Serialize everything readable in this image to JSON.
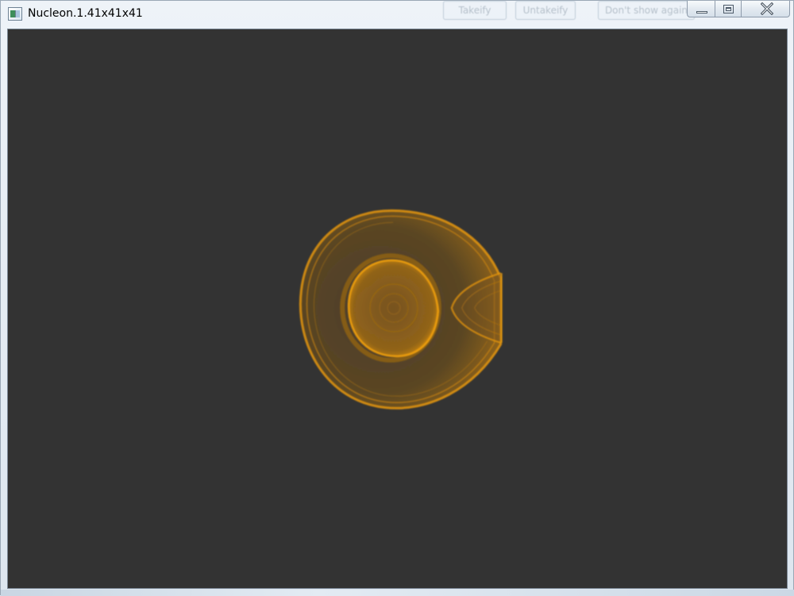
{
  "window": {
    "title": "Nucleon.1.41x41x41",
    "caption_buttons": [
      "minimize",
      "maximize",
      "close"
    ]
  },
  "background_notification": {
    "buttons": [
      "Takeify",
      "Untakeify",
      "Don't show again"
    ]
  },
  "viewport": {
    "background_color": "#333333",
    "render_color": "#e8940c",
    "render_subject": "volume-rendered nucleon density"
  },
  "icons": {
    "app": "app-window-icon",
    "minimize": "minimize-icon",
    "maximize": "maximize-icon",
    "close": "close-icon"
  }
}
